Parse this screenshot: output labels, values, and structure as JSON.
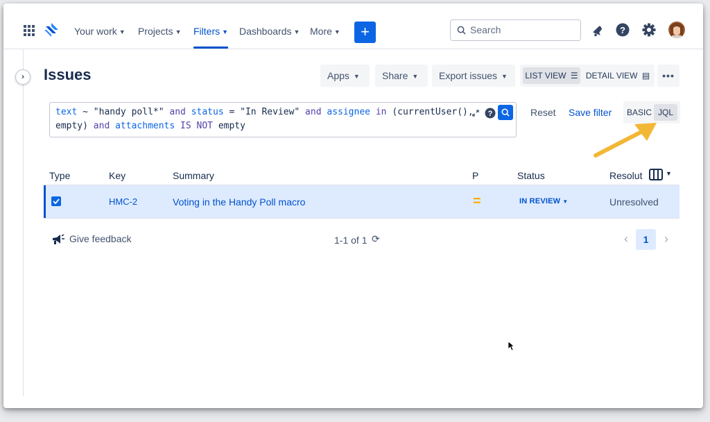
{
  "nav": {
    "items": [
      {
        "label": "Your work"
      },
      {
        "label": "Projects"
      },
      {
        "label": "Filters"
      },
      {
        "label": "Dashboards"
      },
      {
        "label": "More"
      }
    ],
    "create_label": "+",
    "search_placeholder": "Search",
    "accent": "#0052cc"
  },
  "header": {
    "title": "Issues",
    "apps": "Apps",
    "share": "Share",
    "export": "Export issues",
    "list_view": "LIST VIEW",
    "detail_view": "DETAIL VIEW",
    "more": "•••"
  },
  "query": {
    "line1": [
      "text",
      " ~ ",
      "\"handy poll*\"",
      " and ",
      "status",
      " = ",
      "\"In Review\"",
      " and ",
      "assignee",
      " in ",
      "(currentUser(),"
    ],
    "line2": [
      "empty",
      ") ",
      "and",
      " ",
      "attachments",
      " IS NOT ",
      "empty"
    ],
    "reset": "Reset",
    "save_filter": "Save filter",
    "basic": "BASIC",
    "jql": "JQL"
  },
  "table": {
    "headers": [
      "Type",
      "Key",
      "Summary",
      "P",
      "Status",
      "Resolut"
    ],
    "rows": [
      {
        "key": "HMC-2",
        "summary": "Voting in the Handy Poll macro",
        "priority": "=",
        "status": "IN REVIEW",
        "resolution": "Unresolved"
      }
    ]
  },
  "footer": {
    "feedback": "Give feedback",
    "count": "1-1 of 1",
    "page": "1"
  }
}
